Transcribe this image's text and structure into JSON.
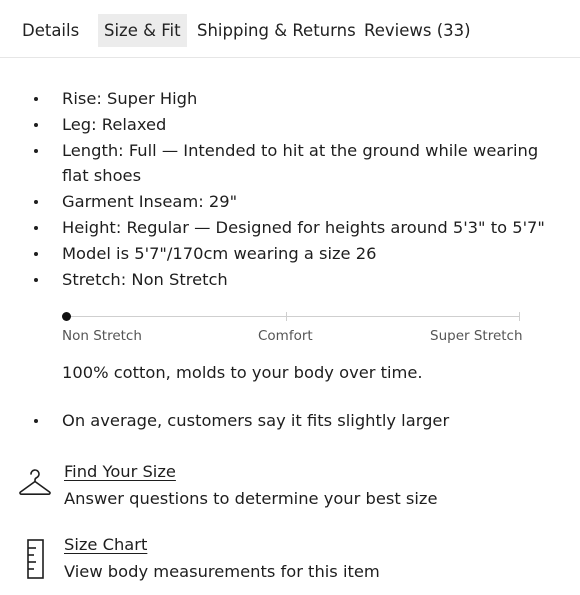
{
  "tabs": [
    {
      "label": "Details",
      "active": false
    },
    {
      "label": "Size & Fit",
      "active": true
    },
    {
      "label": "Shipping & Returns",
      "active": false
    },
    {
      "label": "Reviews (33)",
      "active": false
    }
  ],
  "fit_details": [
    "Rise: Super High",
    "Leg: Relaxed",
    "Length: Full — Intended to hit at the ground while wearing flat shoes",
    "Garment Inseam: 29\"",
    "Height: Regular — Designed for heights around 5'3\" to 5'7\"",
    "Model is 5'7\"/170cm wearing a size 26",
    "Stretch: Non Stretch"
  ],
  "stretch_scale": {
    "labels": [
      "Non Stretch",
      "Comfort",
      "Super Stretch"
    ],
    "selected_level": 0
  },
  "fabric_note": "100% cotton, molds to your body over time.",
  "customer_fit": "On average, customers say it fits slightly larger",
  "find_size": {
    "icon": "hanger-icon",
    "link": "Find Your Size",
    "description": "Answer questions to determine your best size"
  },
  "size_chart": {
    "icon": "ruler-icon",
    "link": "Size Chart",
    "description": "View body measurements for this item"
  }
}
